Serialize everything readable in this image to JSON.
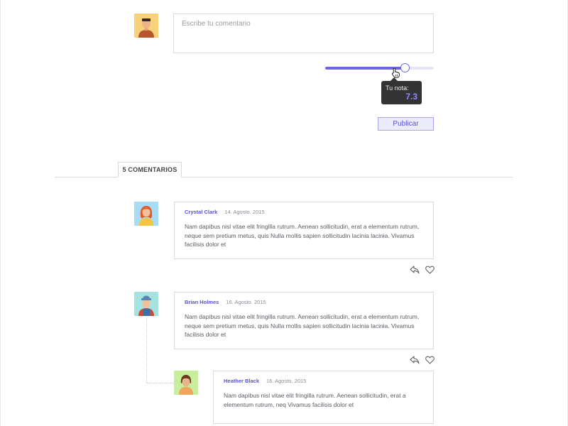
{
  "composer": {
    "placeholder": "Escribe tu comentario",
    "rating_label": "Tu nota:",
    "rating_value": "7.3",
    "rating_max": 10,
    "publish_label": "Publicar"
  },
  "comments_tab": {
    "label": "5 COMENTARIOS"
  },
  "comments": [
    {
      "author": "Crystal Clark",
      "date": "14. Agosto. 2015",
      "text": "Nam dapibus nisl vitae elit fringilla rutrum. Aenean sollicitudin, erat a elementum rutrum, neque sem pretium metus, quis Nulla mollis sapien sollicitudin lacinia lacinia. Vivamus facilisis dolor et"
    },
    {
      "author": "Brian Holmes",
      "date": "16. Agosto. 2015",
      "text": "Nam dapibus nisl vitae elit fringilla rutrum. Aenean sollicitudin, erat a elementum rutrum, neque sem pretium metus, quis Nulla mollis sapien sollicitudin lacinia lacinia. Vivamus facilisis dolor et"
    },
    {
      "author": "Heather Black",
      "date": "16. Agosto. 2015",
      "text": "Nam dapibus nisl vitae elit fringilla rutrum. Aenean sollicitudin, erat a elementum rutrum, neq Vivamus facilisis dolor et"
    }
  ],
  "colors": {
    "accent": "#6c63e6",
    "accent_light": "#e6e3fb",
    "border": "#d9d9e0",
    "tooltip_bg": "#333333"
  },
  "icons": {
    "reply": "reply-icon",
    "like": "heart-icon",
    "cursor": "hand-pointer-icon"
  }
}
